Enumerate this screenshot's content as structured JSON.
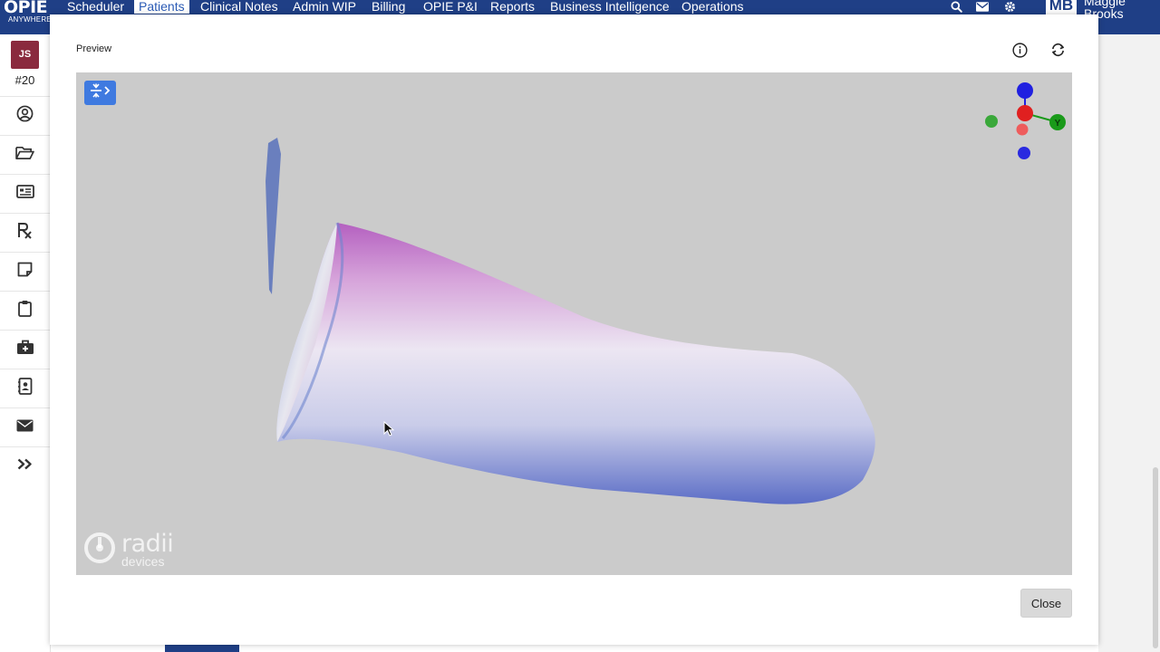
{
  "app": {
    "logo": "OPIE",
    "logo_subtitle": "ANYWHERE"
  },
  "nav": {
    "items": [
      {
        "label": "Scheduler"
      },
      {
        "label": "Patients",
        "active": true
      },
      {
        "label": "Clinical Notes"
      },
      {
        "label": "Admin WIP"
      },
      {
        "label": "Billing"
      },
      {
        "label": "OPIE P&I"
      },
      {
        "label": "Reports"
      },
      {
        "label": "Business Intelligence"
      },
      {
        "label": "Operations"
      }
    ],
    "icons": [
      "search-icon",
      "mail-icon",
      "gear-icon"
    ]
  },
  "user": {
    "initials": "MB",
    "first_name": "Maggie",
    "last_name": "Brooks"
  },
  "patient": {
    "initials": "JS",
    "number": "#20"
  },
  "sidebar": {
    "icons": [
      "user-circle-icon",
      "folder-open-icon",
      "id-card-icon",
      "prescription-icon",
      "sticky-note-icon",
      "clipboard-icon",
      "medkit-icon",
      "address-book-icon",
      "envelope-icon",
      "double-chevron-right-icon"
    ]
  },
  "modal": {
    "title": "Preview",
    "info_icon": "info-icon",
    "refresh_icon": "refresh-icon",
    "close_label": "Close"
  },
  "viewer": {
    "toolbar_icon": "compress-toggle-icon",
    "watermark_main": "radii",
    "watermark_sub": "devices",
    "axis_y_label": "Y",
    "colors": {
      "background": "#cbcbcb",
      "accent": "#3f7ae0",
      "axis_x": "#e02020",
      "axis_y": "#1a9a1a",
      "axis_z": "#2020e0"
    }
  },
  "colors": {
    "nav_bg": "#1f3f86",
    "patient_avatar": "#8a2a3e"
  }
}
